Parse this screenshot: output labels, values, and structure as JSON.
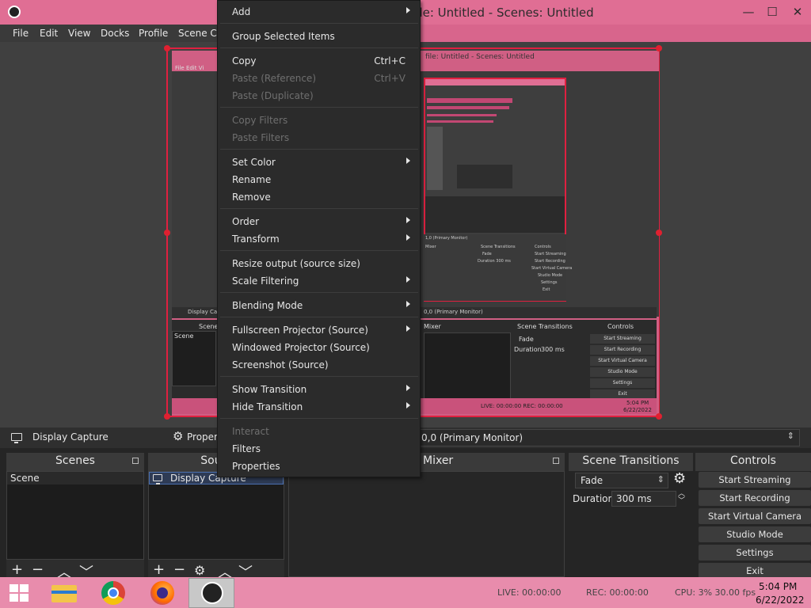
{
  "window": {
    "title": "file: Untitled - Scenes: Untitled",
    "controls": [
      "—",
      "☐",
      "✕"
    ]
  },
  "menubar": [
    "File",
    "Edit",
    "View",
    "Docks",
    "Profile",
    "Scene Co"
  ],
  "context_menu": [
    {
      "label": "Add",
      "submenu": true
    },
    {
      "label": "Group Selected Items"
    },
    {
      "label": "Copy",
      "shortcut": "Ctrl+C"
    },
    {
      "label": "Paste (Reference)",
      "shortcut": "Ctrl+V",
      "disabled": true
    },
    {
      "label": "Paste (Duplicate)",
      "disabled": true
    },
    {
      "label": "Copy Filters",
      "disabled": true
    },
    {
      "label": "Paste Filters",
      "disabled": true
    },
    {
      "label": "Set Color",
      "submenu": true
    },
    {
      "label": "Rename"
    },
    {
      "label": "Remove"
    },
    {
      "label": "Order",
      "submenu": true
    },
    {
      "label": "Transform",
      "submenu": true
    },
    {
      "label": "Resize output (source size)"
    },
    {
      "label": "Scale Filtering",
      "submenu": true
    },
    {
      "label": "Blending Mode",
      "submenu": true
    },
    {
      "label": "Fullscreen Projector (Source)",
      "submenu": true
    },
    {
      "label": "Windowed Projector (Source)"
    },
    {
      "label": "Screenshot (Source)"
    },
    {
      "label": "Show Transition",
      "submenu": true
    },
    {
      "label": "Hide Transition",
      "submenu": true
    },
    {
      "label": "Interact",
      "disabled": true
    },
    {
      "label": "Filters"
    },
    {
      "label": "Properties"
    }
  ],
  "source_bar": {
    "source_name": "Display Capture",
    "properties": "Propert",
    "display_value": "0,0 (Primary Monitor)"
  },
  "docks": {
    "scenes": {
      "title": "Scenes",
      "items": [
        "Scene"
      ]
    },
    "sources": {
      "title": "Sourc",
      "items": [
        "Display Capture"
      ]
    },
    "mixer": {
      "title": "Mixer"
    },
    "transitions": {
      "title": "Scene Transitions",
      "transition": "Fade",
      "duration_label": "Duration",
      "duration_value": "300 ms"
    },
    "controls": {
      "title": "Controls",
      "buttons": [
        "Start Streaming",
        "Start Recording",
        "Start Virtual Camera",
        "Studio Mode",
        "Settings",
        "Exit"
      ]
    }
  },
  "nested_preview": {
    "title": "file: Untitled - Scenes: Untitled",
    "menu": "File   Edit   Vi",
    "source": "Display Cap",
    "display": "0,0 (Primary Monitor)",
    "scene_header": "Scene",
    "scene_item": "Scene",
    "mixer": "Mixer",
    "transitions": "Scene Transitions",
    "transition": "Fade",
    "duration_label": "Duration",
    "duration": "300 ms",
    "controls": "Controls",
    "buttons": [
      "Start Streaming",
      "Start Recording",
      "Start Virtual Camera",
      "Studio Mode",
      "Settings",
      "Exit"
    ],
    "status": "LIVE: 00:00:00    REC: 00:00:00",
    "time": "5:04 PM",
    "date": "6/22/2022"
  },
  "status": {
    "live": "LIVE: 00:00:00",
    "rec": "REC: 00:00:00",
    "cpu_fps": "CPU: 3%  30.00 fps"
  },
  "taskbar": {
    "apps": [
      "start-icon",
      "file-explorer-icon",
      "chrome-icon",
      "firefox-icon",
      "obs-icon"
    ],
    "time": "5:04 PM",
    "date": "6/22/2022"
  },
  "colors": {
    "accent": "#e02040",
    "taskbar": "#e88cac",
    "panel": "#2b2b2b"
  }
}
